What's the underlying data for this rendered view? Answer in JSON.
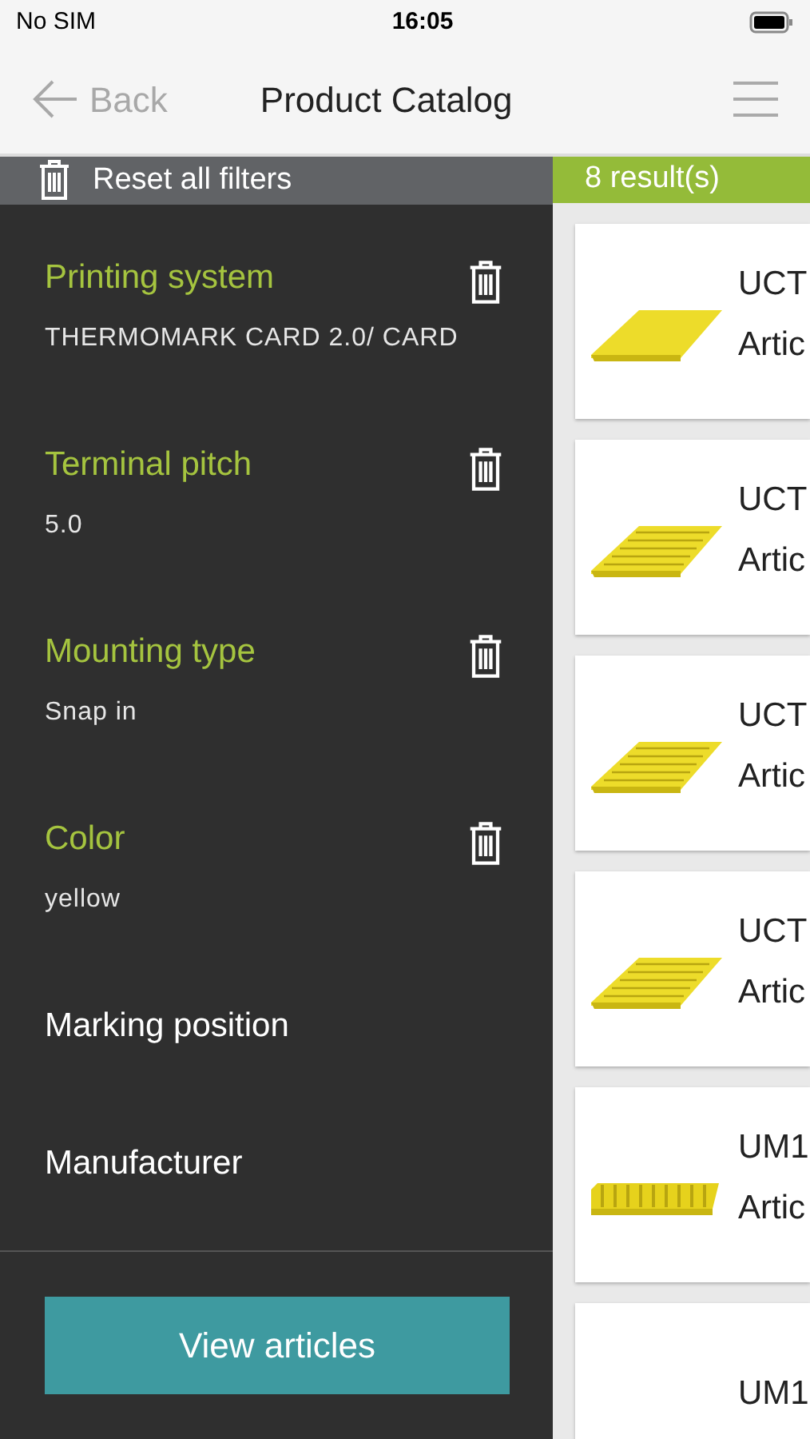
{
  "status_bar": {
    "carrier": "No SIM",
    "time": "16:05"
  },
  "nav": {
    "back": "Back",
    "title": "Product Catalog"
  },
  "reset": {
    "label": "Reset all filters"
  },
  "results": {
    "count": "8 result(s)",
    "items": [
      {
        "title": "UCT",
        "subtitle": "Artic",
        "kind": "picture"
      },
      {
        "title": "UCT",
        "subtitle": "Artic",
        "kind": "picture"
      },
      {
        "title": "UCT",
        "subtitle": "Artic",
        "kind": "picture"
      },
      {
        "title": "UCT",
        "subtitle": "Artic",
        "kind": "picture"
      },
      {
        "title": "UM1",
        "subtitle": "Artic",
        "kind": "picture"
      },
      {
        "title": "UM1"
      }
    ]
  },
  "filters": [
    {
      "label": "Printing system",
      "value": "THERMOMARK CARD 2.0/ CARD",
      "active": true
    },
    {
      "label": "Terminal pitch",
      "value": "5.0",
      "active": true
    },
    {
      "label": "Mounting type",
      "value": "Snap in",
      "active": true
    },
    {
      "label": "Color",
      "value": "yellow",
      "active": true
    },
    {
      "label": "Marking position",
      "active": false
    },
    {
      "label": "Manufacturer",
      "active": false
    }
  ],
  "button": "View articles"
}
